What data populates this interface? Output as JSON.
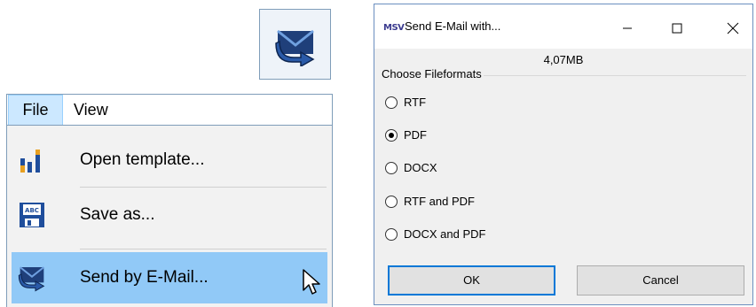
{
  "toolbar_icon": {
    "icon": "send-email-icon"
  },
  "menubar": {
    "items": [
      "File",
      "View"
    ]
  },
  "file_menu": {
    "items": [
      {
        "label": "Open template...",
        "icon": "bar-chart-icon"
      },
      {
        "label": "Save as...",
        "icon": "save-form-icon"
      },
      {
        "label": "Send by E-Mail...",
        "icon": "send-email-icon",
        "highlighted": true
      }
    ]
  },
  "dialog": {
    "app_icon_text": "MSV",
    "title": "Send E-Mail with...",
    "size": "4,07MB",
    "group_title": "Choose Fileformats",
    "options": [
      {
        "label": "RTF",
        "checked": false
      },
      {
        "label": "PDF",
        "checked": true
      },
      {
        "label": "DOCX",
        "checked": false
      },
      {
        "label": "RTF and PDF",
        "checked": false
      },
      {
        "label": "DOCX and PDF",
        "checked": false
      }
    ],
    "ok_label": "OK",
    "cancel_label": "Cancel"
  },
  "colors": {
    "menu_highlight": "#91c9f7",
    "menubar_selected": "#cce8ff",
    "icon_blue": "#1f4e9c",
    "dialog_bg": "#f0f0f0"
  }
}
